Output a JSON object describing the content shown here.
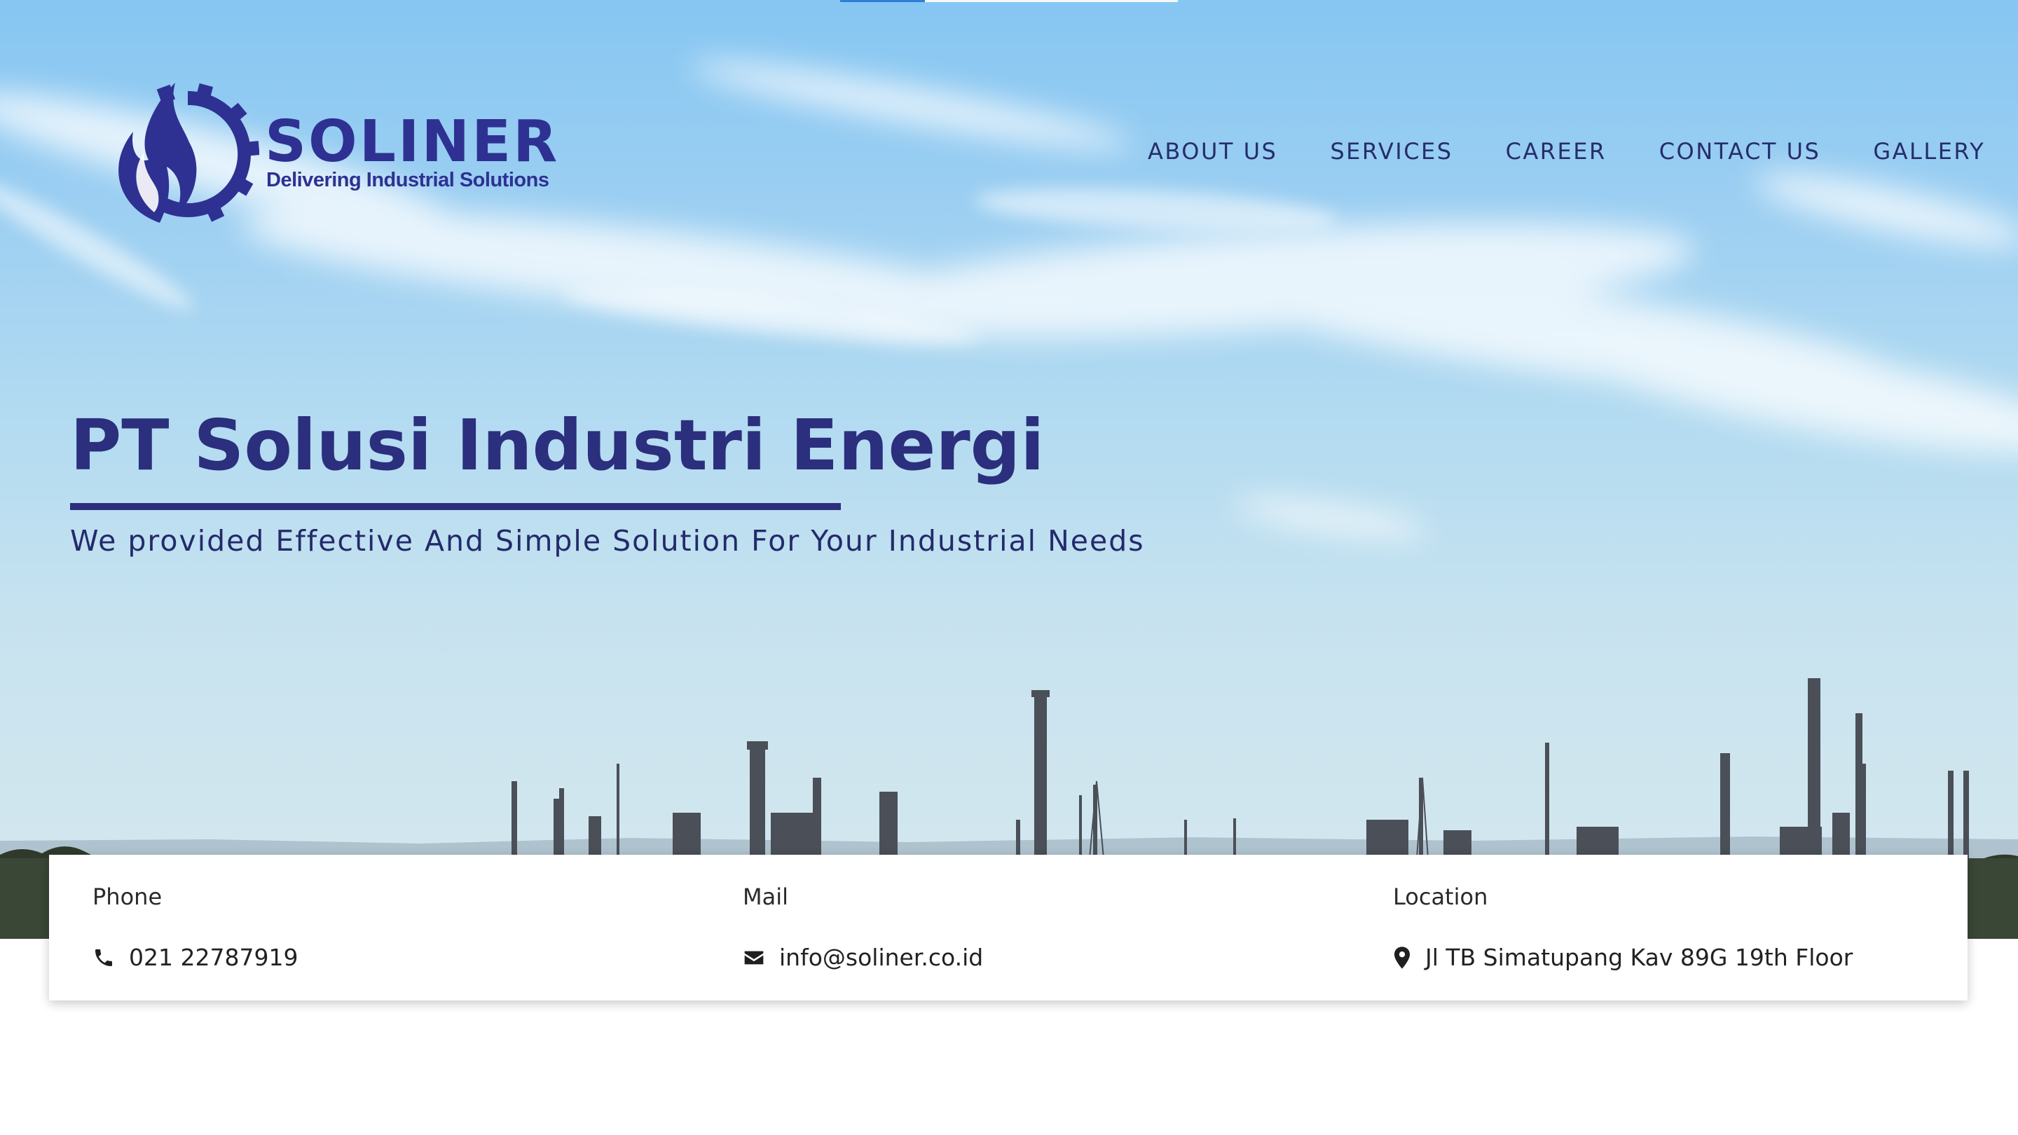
{
  "brand": {
    "name": "SOLINER",
    "tagline": "Delivering Industrial Solutions",
    "color": "#2e3192"
  },
  "slider": {
    "progress": 0.25
  },
  "nav": {
    "items": [
      {
        "label": "ABOUT US",
        "icon": ""
      },
      {
        "label": "SERVICES",
        "icon": ""
      },
      {
        "label": "CAREER",
        "icon": ""
      },
      {
        "label": "CONTACT US",
        "icon": ""
      },
      {
        "label": "GALLERY",
        "icon": ""
      }
    ]
  },
  "hero": {
    "title": "PT Solusi Industri Energi",
    "subtitle": "We provided Effective And Simple Solution For Your Industrial Needs",
    "image": "refinery-skyline"
  },
  "contact": {
    "phone": {
      "label": "Phone",
      "value": "021 22787919",
      "icon": "phone-icon"
    },
    "mail": {
      "label": "Mail",
      "value": "info@soliner.co.id",
      "icon": "envelope-icon"
    },
    "location": {
      "label": "Location",
      "value": "Jl TB Simatupang Kav 89G 19th Floor",
      "icon": "map-pin-icon"
    }
  }
}
